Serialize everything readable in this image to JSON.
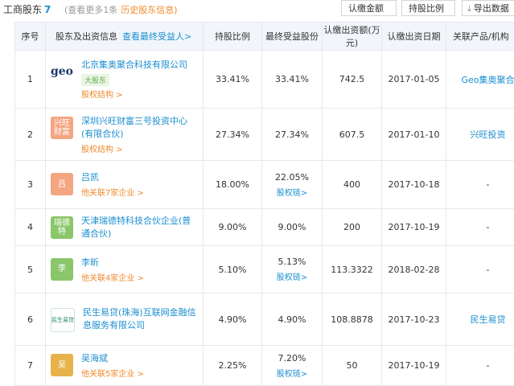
{
  "header": {
    "title": "工商股东",
    "count": "7",
    "note": "(查看更多1条",
    "history_link": "历史股东信息)",
    "btn_capital": "认缴金额",
    "btn_ratio": "持股比例",
    "btn_export": "导出数据"
  },
  "table": {
    "col_index": "序号",
    "col_holder": "股东及出资信息",
    "col_view_ubo": "查看最终受益人>",
    "col_ratio": "持股比例",
    "col_final": "最终受益股份",
    "col_capital": "认缴出资额(万元)",
    "col_date": "认缴出资日期",
    "col_related": "关联产品/机构",
    "rows": [
      {
        "index": "1",
        "logo_text": "geo",
        "logo_color": "#ffffff",
        "name": "北京集奥聚合科技有限公司",
        "tag": "大股东",
        "sub": "股权结构 >",
        "ratio": "33.41%",
        "final": "33.41%",
        "chain": "",
        "capital": "742.5",
        "date": "2017-01-05",
        "related": "Geo集奥聚合"
      },
      {
        "index": "2",
        "logo_text": "兴旺财富",
        "logo_color": "#f4a582",
        "name": "深圳兴旺财富三号投资中心(有限合伙)",
        "tag": "",
        "sub": "股权结构 >",
        "ratio": "27.34%",
        "final": "27.34%",
        "chain": "",
        "capital": "607.5",
        "date": "2017-01-10",
        "related": "兴旺投资"
      },
      {
        "index": "3",
        "logo_text": "吕",
        "logo_color": "#f4a582",
        "name": "吕凯",
        "tag": "",
        "sub": "他关联7家企业 >",
        "ratio": "18.00%",
        "final": "22.05%",
        "chain": "股权链>",
        "capital": "400",
        "date": "2017-10-18",
        "related": "-"
      },
      {
        "index": "4",
        "logo_text": "瑞德特",
        "logo_color": "#8bc66a",
        "name": "天津瑞德特科技合伙企业(普通合伙)",
        "tag": "",
        "sub": "",
        "ratio": "9.00%",
        "final": "9.00%",
        "chain": "",
        "capital": "200",
        "date": "2017-10-19",
        "related": "-"
      },
      {
        "index": "5",
        "logo_text": "李",
        "logo_color": "#8bc66a",
        "name": "李昕",
        "tag": "",
        "sub": "他关联4家企业 >",
        "ratio": "5.10%",
        "final": "5.13%",
        "chain": "股权链>",
        "capital": "113.3322",
        "date": "2018-02-28",
        "related": "-"
      },
      {
        "index": "6",
        "logo_text": "民生易贷",
        "logo_color": "#ffffff",
        "name": "民生易贷(珠海)互联网金融信息服务有限公司",
        "tag": "",
        "sub": "",
        "ratio": "4.90%",
        "final": "4.90%",
        "chain": "",
        "capital": "108.8878",
        "date": "2017-10-23",
        "related": "民生易贷"
      },
      {
        "index": "7",
        "logo_text": "吴",
        "logo_color": "#e8b24a",
        "name": "吴海斌",
        "tag": "",
        "sub": "他关联5家企业 >",
        "ratio": "2.25%",
        "final": "7.20%",
        "chain": "股权链>",
        "capital": "50",
        "date": "2017-10-19",
        "related": "-"
      }
    ]
  }
}
